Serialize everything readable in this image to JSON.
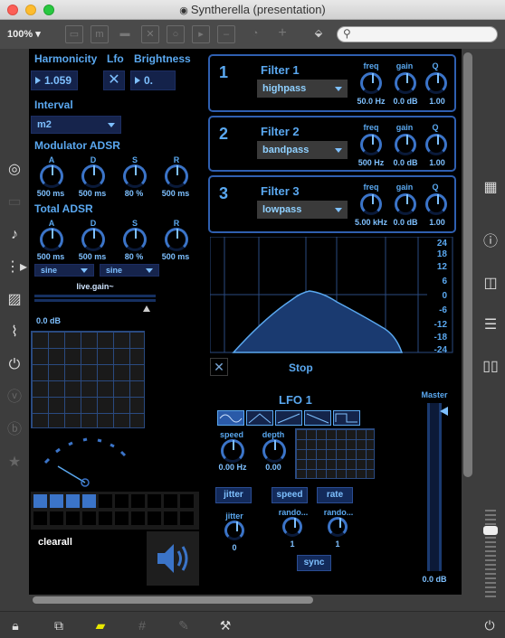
{
  "window": {
    "title": "Syntherella (presentation)",
    "zoom": "100%"
  },
  "colors": {
    "accent": "#5aa8f0",
    "panel_bg": "#000000",
    "border": "#2f5fb0"
  },
  "params": {
    "harmonicity_label": "Harmonicity",
    "harmonicity_value": "1.059",
    "lfo_label": "Lfo",
    "brightness_label": "Brightness",
    "brightness_value": "0.",
    "interval_label": "Interval",
    "interval_value": "m2"
  },
  "mod_adsr": {
    "title": "Modulator ADSR",
    "knobs": [
      {
        "label": "A",
        "value": "500 ms"
      },
      {
        "label": "D",
        "value": "500 ms"
      },
      {
        "label": "S",
        "value": "80 %"
      },
      {
        "label": "R",
        "value": "500 ms"
      }
    ]
  },
  "total_adsr": {
    "title": "Total ADSR",
    "knobs": [
      {
        "label": "A",
        "value": "500 ms"
      },
      {
        "label": "D",
        "value": "500 ms"
      },
      {
        "label": "S",
        "value": "80 %"
      },
      {
        "label": "R",
        "value": "500 ms"
      }
    ]
  },
  "osc": {
    "wave1": "sine",
    "wave2": "sine"
  },
  "gain": {
    "label": "live.gain~",
    "value": "0.0 dB"
  },
  "filters": [
    {
      "num": "1",
      "title": "Filter 1",
      "type": "highpass",
      "freq_label": "freq",
      "gain_label": "gain",
      "q_label": "Q",
      "freq": "50.0 Hz",
      "gain": "0.0 dB",
      "q": "1.00"
    },
    {
      "num": "2",
      "title": "Filter 2",
      "type": "bandpass",
      "freq_label": "freq",
      "gain_label": "gain",
      "q_label": "Q",
      "freq": "500 Hz",
      "gain": "0.0 dB",
      "q": "1.00"
    },
    {
      "num": "3",
      "title": "Filter 3",
      "type": "lowpass",
      "freq_label": "freq",
      "gain_label": "gain",
      "q_label": "Q",
      "freq": "5.00 kHz",
      "gain": "0.0 dB",
      "q": "1.00"
    }
  ],
  "eq_scale": [
    "24",
    "18",
    "12",
    "6",
    "0",
    "-6",
    "-12",
    "-18",
    "-24"
  ],
  "stop_label": "Stop",
  "lfo": {
    "title": "LFO 1",
    "shapes": [
      "sine-wave-icon",
      "triangle-wave-icon",
      "ramp-up-icon",
      "ramp-down-icon",
      "square-wave-icon"
    ],
    "speed_label": "speed",
    "speed_value": "0.00 Hz",
    "depth_label": "depth",
    "depth_value": "0.00",
    "jitter_btn": "jitter",
    "speed_btn": "speed",
    "rate_btn": "rate",
    "jitter_label": "jitter",
    "jitter_value": "0",
    "rando1_label": "rando...",
    "rando1_value": "1",
    "rando2_label": "rando...",
    "rando2_value": "1",
    "sync_btn": "sync"
  },
  "master": {
    "label": "Master",
    "value": "0.0 dB"
  },
  "clearall_label": "clearall",
  "step_seq": {
    "active_steps": 4,
    "total_steps": 8
  }
}
